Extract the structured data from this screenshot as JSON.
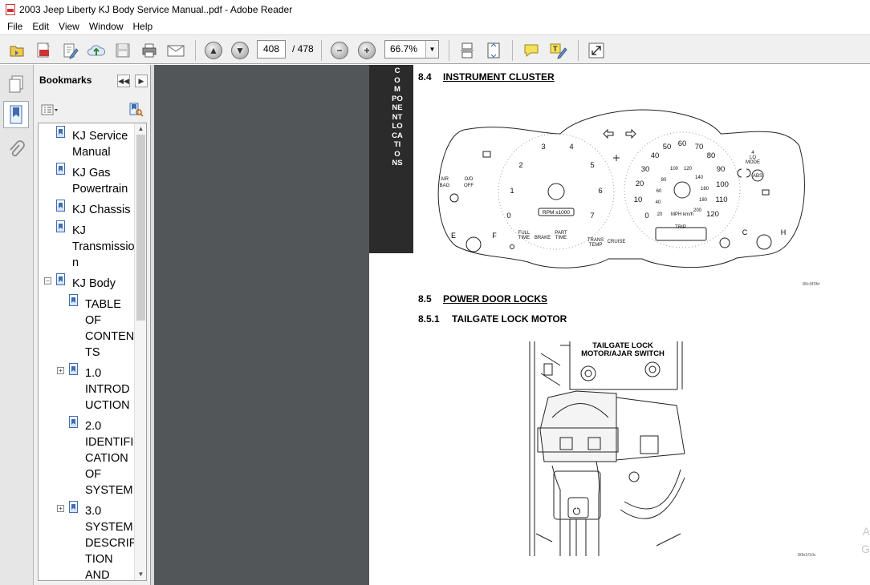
{
  "window": {
    "title": "2003 Jeep Liberty KJ Body Service Manual..pdf - Adobe Reader"
  },
  "menu": [
    "File",
    "Edit",
    "View",
    "Window",
    "Help"
  ],
  "toolbar": {
    "icons": [
      "open-icon",
      "create-pdf-icon",
      "edit-icon",
      "upload-icon",
      "save-icon",
      "print-icon",
      "email-icon",
      "page-up-icon",
      "page-down-icon",
      "zoom-out-icon",
      "zoom-in-icon",
      "scroll-mode-icon",
      "fit-page-icon",
      "comment-icon",
      "highlight-icon",
      "expand-icon"
    ],
    "current_page": "408",
    "total_pages": "/ 478",
    "zoom": "66.7%"
  },
  "bookmarks": {
    "header": "Bookmarks",
    "items": [
      {
        "lines": [
          "KJ Service",
          "Manual"
        ],
        "level": 1,
        "expander": ""
      },
      {
        "lines": [
          "KJ Gas",
          "Powertrain"
        ],
        "level": 1,
        "expander": ""
      },
      {
        "lines": [
          "KJ Chassis"
        ],
        "level": 1,
        "expander": ""
      },
      {
        "lines": [
          "KJ",
          "Transmissio",
          "n"
        ],
        "level": 1,
        "expander": ""
      },
      {
        "lines": [
          "KJ Body"
        ],
        "level": 1,
        "expander": "−"
      },
      {
        "lines": [
          "TABLE",
          "OF",
          "CONTEN",
          "TS"
        ],
        "level": 2,
        "expander": ""
      },
      {
        "lines": [
          "1.0",
          "INTROD",
          "UCTION"
        ],
        "level": 2,
        "expander": "+"
      },
      {
        "lines": [
          "2.0",
          "IDENTIFI",
          "CATION",
          "OF",
          "SYSTEM"
        ],
        "level": 2,
        "expander": ""
      },
      {
        "lines": [
          "3.0",
          "SYSTEM",
          "DESCRIP",
          "TION",
          "AND"
        ],
        "level": 2,
        "expander": "+"
      }
    ]
  },
  "page": {
    "side_tab": "COMPONENT LOCATIONS",
    "sections": [
      {
        "num": "8.4",
        "title": "INSTRUMENT CLUSTER",
        "underline": true
      },
      {
        "num": "8.5",
        "title": "POWER DOOR LOCKS",
        "underline": true
      },
      {
        "num": "8.5.1",
        "title": "TAILGATE LOCK MOTOR",
        "underline": false
      }
    ],
    "cluster": {
      "tach_numbers": [
        "0",
        "1",
        "2",
        "3",
        "4",
        "5",
        "6",
        "7"
      ],
      "tach_label": "RPM x1000",
      "speed_mph": [
        "0",
        "10",
        "20",
        "30",
        "40",
        "50",
        "60",
        "70",
        "80",
        "90",
        "100",
        "110",
        "120"
      ],
      "speed_kmh": [
        "20",
        "40",
        "60",
        "80",
        "100",
        "120",
        "140",
        "160",
        "180",
        "200"
      ],
      "speed_unit": "MPH km/h",
      "indicators_left": [
        "AIR",
        "BAG",
        "O/D",
        "OFF"
      ],
      "indicators_bottom": [
        "FULL",
        "TIME",
        "BRAKE",
        "PART",
        "TIME",
        "TRANS",
        "TEMP",
        "CRUISE"
      ],
      "trip": "TRIP",
      "fuel": [
        "E",
        "F"
      ],
      "temp": [
        "C",
        "H"
      ],
      "right_indicators": [
        "4",
        "LO",
        "MODE",
        "ABS"
      ],
      "fig_id": "80c9f3fd"
    },
    "tailgate": {
      "label_lines": [
        "TAILGATE LOCK",
        "MOTOR/AJAR SWITCH"
      ],
      "fig_id": "80b1f10c"
    },
    "watermark": [
      "A",
      "G"
    ]
  }
}
